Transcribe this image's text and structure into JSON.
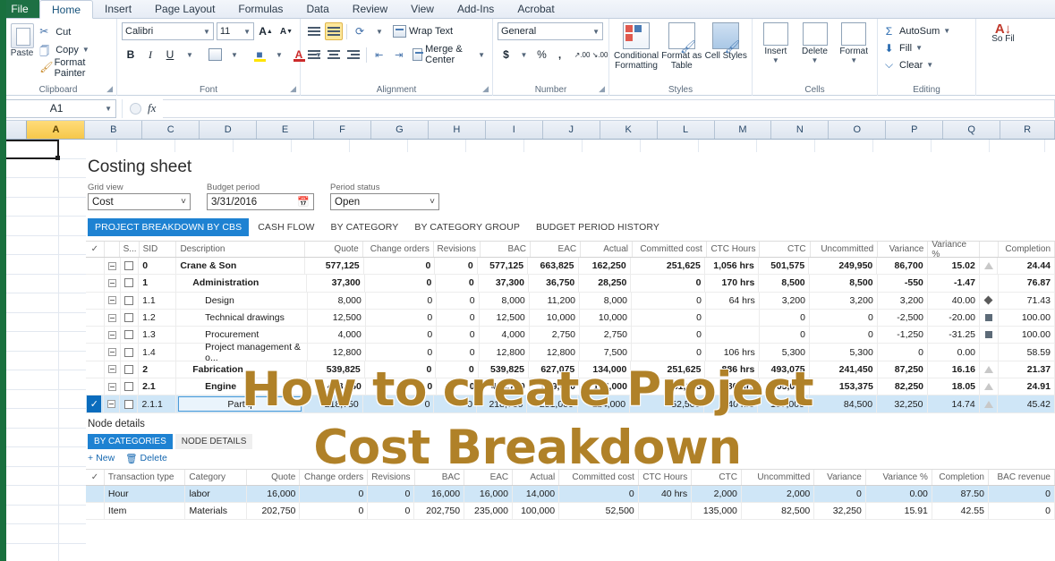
{
  "window": {
    "ribbon_tabs": [
      "File",
      "Home",
      "Insert",
      "Page Layout",
      "Formulas",
      "Data",
      "Review",
      "View",
      "Add-Ins",
      "Acrobat"
    ],
    "active_tab": "Home"
  },
  "ribbon": {
    "clipboard": {
      "title": "Clipboard",
      "paste_label": "Paste",
      "items": [
        {
          "label": "Cut",
          "icon": "scissors-icon"
        },
        {
          "label": "Copy",
          "icon": "copy-icon"
        },
        {
          "label": "Format Painter",
          "icon": "format-painter-icon"
        }
      ]
    },
    "font": {
      "title": "Font",
      "font_name": "Calibri",
      "font_size": "11",
      "grow_label": "A",
      "shrink_label": "A",
      "bold": "B",
      "italic": "I",
      "underline": "U"
    },
    "alignment": {
      "title": "Alignment",
      "wrap_text": "Wrap Text",
      "merge_center": "Merge & Center"
    },
    "number": {
      "title": "Number",
      "format": "General",
      "currency": "$",
      "percent": "%",
      "comma": ",",
      "inc_dec": ".00",
      "dec_dec": ".00"
    },
    "styles": {
      "title": "Styles",
      "items": [
        "Conditional Formatting",
        "Format as Table",
        "Cell Styles"
      ]
    },
    "cells": {
      "title": "Cells",
      "items": [
        "Insert",
        "Delete",
        "Format"
      ]
    },
    "editing": {
      "title": "Editing",
      "items": [
        "AutoSum",
        "Fill",
        "Clear"
      ],
      "sort_filter": "So Fil"
    }
  },
  "formula_bar": {
    "name_box": "A1",
    "fx_label": "fx",
    "formula": ""
  },
  "grid": {
    "columns": [
      "A",
      "B",
      "C",
      "D",
      "E",
      "F",
      "G",
      "H",
      "I",
      "J",
      "K",
      "L",
      "M",
      "N",
      "O",
      "P",
      "Q",
      "R"
    ],
    "selected_cell": "A1"
  },
  "panel": {
    "title": "Costing sheet",
    "filters": [
      {
        "label": "Grid view",
        "value": "Cost",
        "type": "dropdown"
      },
      {
        "label": "Budget period",
        "value": "3/31/2016",
        "type": "date"
      },
      {
        "label": "Period status",
        "value": "Open",
        "type": "dropdown"
      }
    ],
    "tabs": [
      {
        "label": "PROJECT BREAKDOWN BY CBS",
        "active": true
      },
      {
        "label": "CASH FLOW",
        "active": false
      },
      {
        "label": "BY CATEGORY",
        "active": false
      },
      {
        "label": "BY CATEGORY GROUP",
        "active": false
      },
      {
        "label": "BUDGET PERIOD HISTORY",
        "active": false
      }
    ],
    "main_table": {
      "headers": [
        "✓",
        "",
        "S...",
        "SID",
        "Description",
        "Quote",
        "Change orders",
        "Revisions",
        "BAC",
        "EAC",
        "Actual",
        "Committed cost",
        "CTC Hours",
        "CTC",
        "Uncommitted",
        "Variance",
        "Variance %",
        "",
        "Completion"
      ],
      "rows": [
        {
          "checked": false,
          "sid": "0",
          "indent": 0,
          "bold": true,
          "description": "Crane & Son",
          "quote": "577,125",
          "change_orders": "0",
          "revisions": "0",
          "bac": "577,125",
          "eac": "663,825",
          "actual": "162,250",
          "committed": "251,625",
          "ctc_hours": "1,056 hrs",
          "ctc": "501,575",
          "uncommitted": "249,950",
          "variance": "86,700",
          "variance_pct": "15.02",
          "status": "triangle",
          "completion": "24.44"
        },
        {
          "checked": false,
          "sid": "1",
          "indent": 1,
          "bold": true,
          "description": "Administration",
          "quote": "37,300",
          "change_orders": "0",
          "revisions": "0",
          "bac": "37,300",
          "eac": "36,750",
          "actual": "28,250",
          "committed": "0",
          "ctc_hours": "170 hrs",
          "ctc": "8,500",
          "uncommitted": "8,500",
          "variance": "-550",
          "variance_pct": "-1.47",
          "status": "",
          "completion": "76.87"
        },
        {
          "checked": false,
          "sid": "1.1",
          "indent": 2,
          "bold": false,
          "description": "Design",
          "quote": "8,000",
          "change_orders": "0",
          "revisions": "0",
          "bac": "8,000",
          "eac": "11,200",
          "actual": "8,000",
          "committed": "0",
          "ctc_hours": "64 hrs",
          "ctc": "3,200",
          "uncommitted": "3,200",
          "variance": "3,200",
          "variance_pct": "40.00",
          "status": "diamond",
          "completion": "71.43"
        },
        {
          "checked": false,
          "sid": "1.2",
          "indent": 2,
          "bold": false,
          "description": "Technical drawings",
          "quote": "12,500",
          "change_orders": "0",
          "revisions": "0",
          "bac": "12,500",
          "eac": "10,000",
          "actual": "10,000",
          "committed": "0",
          "ctc_hours": "",
          "ctc": "0",
          "uncommitted": "0",
          "variance": "-2,500",
          "variance_pct": "-20.00",
          "status": "square",
          "completion": "100.00"
        },
        {
          "checked": false,
          "sid": "1.3",
          "indent": 2,
          "bold": false,
          "description": "Procurement",
          "quote": "4,000",
          "change_orders": "0",
          "revisions": "0",
          "bac": "4,000",
          "eac": "2,750",
          "actual": "2,750",
          "committed": "0",
          "ctc_hours": "",
          "ctc": "0",
          "uncommitted": "0",
          "variance": "-1,250",
          "variance_pct": "-31.25",
          "status": "square",
          "completion": "100.00"
        },
        {
          "checked": false,
          "sid": "1.4",
          "indent": 2,
          "bold": false,
          "description": "Project management & o...",
          "quote": "12,800",
          "change_orders": "0",
          "revisions": "0",
          "bac": "12,800",
          "eac": "12,800",
          "actual": "7,500",
          "committed": "0",
          "ctc_hours": "106 hrs",
          "ctc": "5,300",
          "uncommitted": "5,300",
          "variance": "0",
          "variance_pct": "0.00",
          "status": "",
          "completion": "58.59"
        },
        {
          "checked": false,
          "sid": "2",
          "indent": 1,
          "bold": true,
          "description": "Fabrication",
          "quote": "539,825",
          "change_orders": "0",
          "revisions": "0",
          "bac": "539,825",
          "eac": "627,075",
          "actual": "134,000",
          "committed": "251,625",
          "ctc_hours": "886 hrs",
          "ctc": "493,075",
          "uncommitted": "241,450",
          "variance": "87,250",
          "variance_pct": "16.16",
          "status": "triangle",
          "completion": "21.37"
        },
        {
          "checked": false,
          "sid": "2.1",
          "indent": 2,
          "bold": true,
          "description": "Engine",
          "quote": "458,750",
          "change_orders": "0",
          "revisions": "0",
          "bac": "458,750",
          "eac": "539,000",
          "actual": "134,000",
          "committed": "251,625",
          "ctc_hours": "180 hrs",
          "ctc": "405,000",
          "uncommitted": "153,375",
          "variance": "82,250",
          "variance_pct": "18.05",
          "status": "triangle",
          "completion": "24.91"
        },
        {
          "checked": true,
          "sid": "2.1.1",
          "indent": 3,
          "bold": false,
          "description": "Part I",
          "editing": true,
          "quote": "218,750",
          "change_orders": "0",
          "revisions": "0",
          "bac": "218,750",
          "eac": "251,000",
          "actual": "114,000",
          "committed": "52,500",
          "ctc_hours": "40 hrs",
          "ctc": "137,000",
          "uncommitted": "84,500",
          "variance": "32,250",
          "variance_pct": "14.74",
          "status": "triangle",
          "completion": "45.42"
        }
      ]
    },
    "node_details": {
      "title": "Node details",
      "tabs": [
        {
          "label": "BY CATEGORIES",
          "active": true
        },
        {
          "label": "NODE DETAILS",
          "active": false
        }
      ],
      "actions": [
        {
          "label": "New",
          "icon": "plus-icon"
        },
        {
          "label": "Delete",
          "icon": "trash-icon"
        }
      ],
      "headers": [
        "✓",
        "Transaction type",
        "Category",
        "Quote",
        "Change orders",
        "Revisions",
        "BAC",
        "EAC",
        "Actual",
        "Committed cost",
        "CTC Hours",
        "CTC",
        "Uncommitted",
        "Variance",
        "Variance %",
        "Completion",
        "BAC revenue"
      ],
      "rows": [
        {
          "selected": true,
          "transaction_type": "Hour",
          "category": "labor",
          "quote": "16,000",
          "change_orders": "0",
          "revisions": "0",
          "bac": "16,000",
          "eac": "16,000",
          "actual": "14,000",
          "committed": "0",
          "ctc_hours": "40 hrs",
          "ctc": "2,000",
          "uncommitted": "2,000",
          "variance": "0",
          "variance_pct": "0.00",
          "completion": "87.50",
          "bac_revenue": "0"
        },
        {
          "selected": false,
          "transaction_type": "Item",
          "category": "Materials",
          "quote": "202,750",
          "change_orders": "0",
          "revisions": "0",
          "bac": "202,750",
          "eac": "235,000",
          "actual": "100,000",
          "committed": "52,500",
          "ctc_hours": "",
          "ctc": "135,000",
          "uncommitted": "82,500",
          "variance": "32,250",
          "variance_pct": "15.91",
          "completion": "42.55",
          "bac_revenue": "0"
        }
      ]
    }
  },
  "overlay": {
    "line1": "How to create Project",
    "line2": "Cost Breakdown",
    "color": "#b08128"
  }
}
